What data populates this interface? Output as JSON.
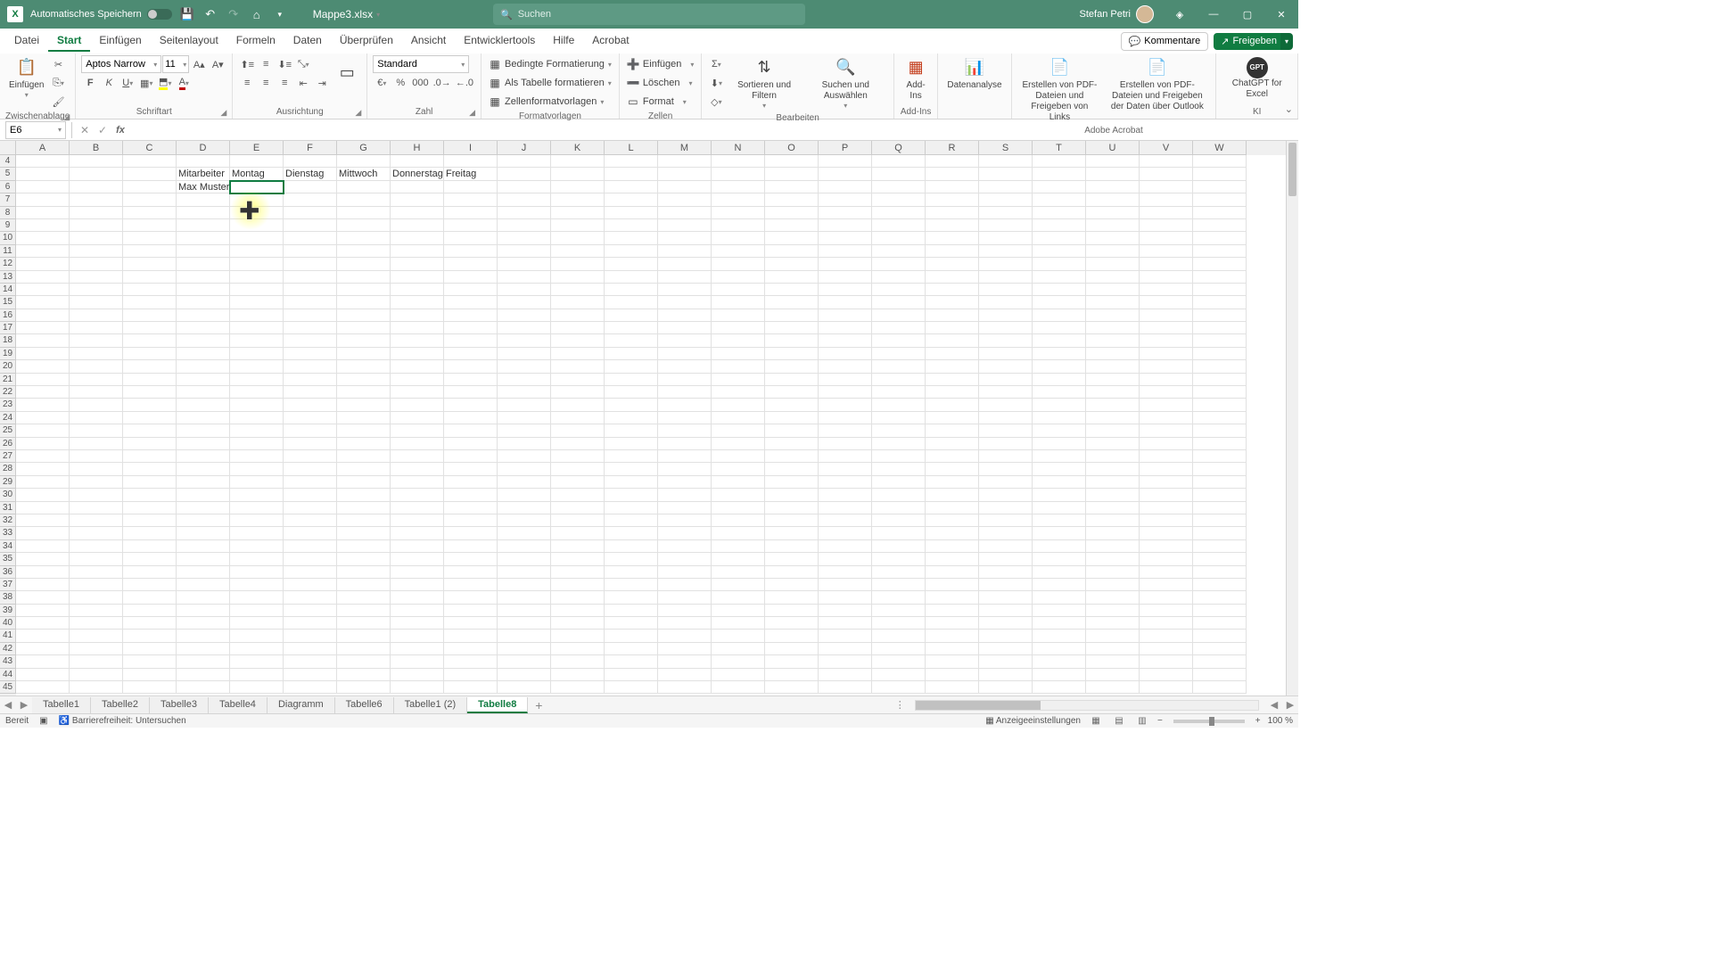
{
  "titlebar": {
    "autosave_label": "Automatisches Speichern",
    "filename": "Mappe3.xlsx",
    "search_placeholder": "Suchen",
    "user_name": "Stefan Petri"
  },
  "menu": {
    "tabs": [
      "Datei",
      "Start",
      "Einfügen",
      "Seitenlayout",
      "Formeln",
      "Daten",
      "Überprüfen",
      "Ansicht",
      "Entwicklertools",
      "Hilfe",
      "Acrobat"
    ],
    "active": "Start",
    "comments": "Kommentare",
    "share": "Freigeben"
  },
  "ribbon": {
    "clipboard": {
      "paste": "Einfügen",
      "label": "Zwischenablage"
    },
    "font": {
      "name": "Aptos Narrow",
      "size": "11",
      "label": "Schriftart"
    },
    "align": {
      "label": "Ausrichtung"
    },
    "number": {
      "format": "Standard",
      "label": "Zahl"
    },
    "styles": {
      "cond": "Bedingte Formatierung",
      "table": "Als Tabelle formatieren",
      "cell": "Zellenformatvorlagen",
      "label": "Formatvorlagen"
    },
    "cells": {
      "insert": "Einfügen",
      "delete": "Löschen",
      "format": "Format",
      "label": "Zellen"
    },
    "editing": {
      "sort": "Sortieren und Filtern",
      "find": "Suchen und Auswählen",
      "label": "Bearbeiten"
    },
    "addins": {
      "btn": "Add-Ins",
      "label": "Add-Ins"
    },
    "analysis": "Datenanalyse",
    "pdf1": "Erstellen von PDF-Dateien und Freigeben von Links",
    "pdf2": "Erstellen von PDF-Dateien und Freigeben der Daten über Outlook",
    "acrobat_label": "Adobe Acrobat",
    "gpt": "ChatGPT for Excel",
    "ki_label": "KI"
  },
  "formula": {
    "namebox": "E6",
    "value": ""
  },
  "grid": {
    "cols": [
      "A",
      "B",
      "C",
      "D",
      "E",
      "F",
      "G",
      "H",
      "I",
      "J",
      "K",
      "L",
      "M",
      "N",
      "O",
      "P",
      "Q",
      "R",
      "S",
      "T",
      "U",
      "V",
      "W"
    ],
    "first_row": 4,
    "row_count": 42,
    "selected": {
      "row": 6,
      "col": "E"
    },
    "data": {
      "5": {
        "D": "Mitarbeiter",
        "E": "Montag",
        "F": "Dienstag",
        "G": "Mittwoch",
        "H": "Donnerstag",
        "I": "Freitag"
      },
      "6": {
        "D": "Max Mustermann"
      }
    }
  },
  "sheets": {
    "tabs": [
      "Tabelle1",
      "Tabelle2",
      "Tabelle3",
      "Tabelle4",
      "Diagramm",
      "Tabelle6",
      "Tabelle1 (2)",
      "Tabelle8"
    ],
    "active": "Tabelle8"
  },
  "status": {
    "ready": "Bereit",
    "access": "Barrierefreiheit: Untersuchen",
    "display": "Anzeigeeinstellungen",
    "zoom": "100 %"
  }
}
